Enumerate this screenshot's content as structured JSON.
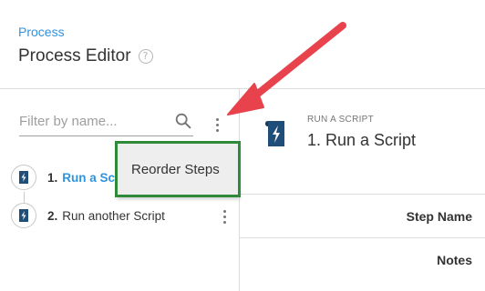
{
  "header": {
    "breadcrumb": "Process",
    "title": "Process Editor",
    "help_icon": "question-circle-icon"
  },
  "sidebar": {
    "filter_placeholder": "Filter by name...",
    "steps": [
      {
        "number": "1.",
        "name": "Run a Sc",
        "active": true,
        "icon": "script-icon"
      },
      {
        "number": "2.",
        "name": "Run another Script",
        "active": false,
        "icon": "script-icon"
      }
    ]
  },
  "menu": {
    "items": [
      "Reorder Steps"
    ]
  },
  "main": {
    "step_kind": "RUN A SCRIPT",
    "step_title": "1.  Run a Script",
    "fields": [
      "Step Name",
      "Notes"
    ]
  },
  "colors": {
    "accent": "#2f93e0",
    "callout_arrow": "#e8424c",
    "highlight_border": "#2f8a3a"
  }
}
